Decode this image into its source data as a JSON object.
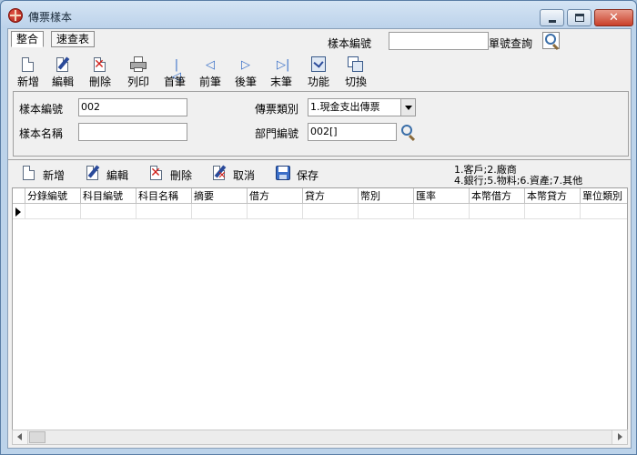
{
  "window": {
    "title": "傳票樣本"
  },
  "tabs": [
    {
      "label": "整合",
      "active": true
    },
    {
      "label": "速查表",
      "active": false
    }
  ],
  "lookup": {
    "label": "樣本編號",
    "value": "",
    "query_label": "單號查詢"
  },
  "toolbar": [
    {
      "label": "新增",
      "icon": "new-document-icon"
    },
    {
      "label": "編輯",
      "icon": "edit-icon"
    },
    {
      "label": "刪除",
      "icon": "delete-icon"
    },
    {
      "label": "列印",
      "icon": "print-icon"
    },
    {
      "label": "首筆",
      "icon": "first-record-icon"
    },
    {
      "label": "前筆",
      "icon": "previous-record-icon"
    },
    {
      "label": "後筆",
      "icon": "next-record-icon"
    },
    {
      "label": "末筆",
      "icon": "last-record-icon"
    },
    {
      "label": "功能",
      "icon": "function-icon"
    },
    {
      "label": "切換",
      "icon": "switch-icon"
    }
  ],
  "form": {
    "sample_no_label": "樣本編號",
    "sample_no_value": "002",
    "sample_name_label": "樣本名稱",
    "sample_name_value": "",
    "voucher_type_label": "傳票類別",
    "voucher_type_value": "1.現金支出傳票",
    "dept_no_label": "部門編號",
    "dept_no_value": "002[]"
  },
  "detail_toolbar": [
    {
      "label": "新增",
      "icon": "new-document-icon"
    },
    {
      "label": "編輯",
      "icon": "edit-icon"
    },
    {
      "label": "刪除",
      "icon": "delete-icon"
    },
    {
      "label": "取消",
      "icon": "cancel-icon"
    },
    {
      "label": "保存",
      "icon": "save-icon"
    }
  ],
  "legend": {
    "line1": "1.客戶;2.廠商",
    "line2": "4.銀行;5.物料;6.資產;7.其他"
  },
  "grid": {
    "columns": [
      "分錄編號",
      "科目編號",
      "科目名稱",
      "摘要",
      "借方",
      "貸方",
      "幣別",
      "匯率",
      "本幣借方",
      "本幣貸方",
      "單位類別"
    ]
  },
  "colors": {
    "window_frame": "#bcd3ea",
    "client_bg": "#f0f0f0",
    "close_button": "#c9402a",
    "icon_blue": "#3a70c8"
  }
}
